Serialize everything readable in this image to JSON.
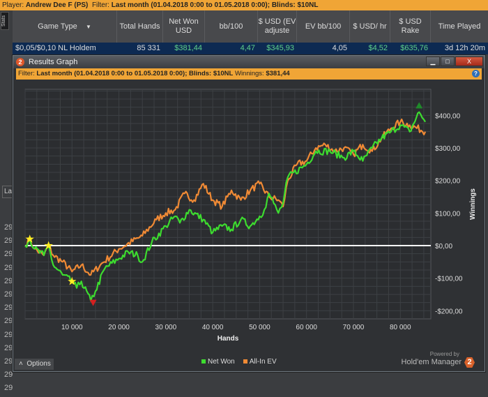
{
  "topbar": {
    "player_label": "Player:",
    "player": "Andrew Dee F (PS)",
    "filter_label": "Filter:",
    "filter": "Last month (01.04.2018 0:00 to 01.05.2018 0:00); Blinds: $10NL"
  },
  "stats_tab": "Stats",
  "table": {
    "headers": [
      "Game Type",
      "Total Hands",
      "Net Won USD",
      "bb/100",
      "$ USD (EV adjuste",
      "EV bb/100",
      "$ USD/ hr",
      "$ USD Rake",
      "Time Played"
    ],
    "row": [
      "$0,05/$0,10 NL Holdem",
      "85 331",
      "$381,44",
      "4,47",
      "$345,93",
      "4,05",
      "$4,52",
      "$635,76",
      "3d 12h 20m"
    ]
  },
  "left": {
    "la": "La",
    "rows": [
      "29",
      "29",
      "29",
      "29",
      "29",
      "29",
      "29",
      "29",
      "29",
      "29",
      "29",
      "29",
      "29"
    ]
  },
  "window": {
    "title": "Results Graph",
    "filter_label": "Filter:",
    "filter": "Last month (01.04.2018 0:00 to 01.05.2018 0:00); Blinds: $10NL",
    "winnings_label": "Winnings:",
    "winnings": "$381,44",
    "options": "Options",
    "powered": "Powered by",
    "brand": "Hold'em Manager",
    "brand_num": "2"
  },
  "colors": {
    "net_won": "#3ddc2f",
    "all_in_ev": "#f08a35",
    "accent": "#f0a536"
  },
  "chart_data": {
    "type": "line",
    "xlabel": "Hands",
    "ylabel": "Winnings",
    "xlim": [
      0,
      86500
    ],
    "ylim": [
      -225,
      480
    ],
    "xticks": [
      10000,
      20000,
      30000,
      40000,
      50000,
      60000,
      70000,
      80000
    ],
    "xtick_labels": [
      "10 000",
      "20 000",
      "30 000",
      "40 000",
      "50 000",
      "60 000",
      "70 000",
      "80 000"
    ],
    "yticks": [
      -200,
      -100,
      0,
      100,
      200,
      300,
      400
    ],
    "ytick_labels": [
      "-$200,00",
      "-$100,00",
      "$0,00",
      "$100,00",
      "$200,00",
      "$300,00",
      "$400,00"
    ],
    "grid": true,
    "legend": "bottom",
    "series": [
      {
        "name": "Net Won",
        "color": "#3ddc2f",
        "points": [
          [
            0,
            0
          ],
          [
            1000,
            20
          ],
          [
            2000,
            -10
          ],
          [
            4000,
            -30
          ],
          [
            5000,
            0
          ],
          [
            6000,
            -60
          ],
          [
            8000,
            -90
          ],
          [
            10000,
            -110
          ],
          [
            11000,
            -130
          ],
          [
            12000,
            -110
          ],
          [
            14000,
            -170
          ],
          [
            15000,
            -140
          ],
          [
            17000,
            -70
          ],
          [
            20000,
            -40
          ],
          [
            22000,
            -20
          ],
          [
            24000,
            -30
          ],
          [
            25000,
            -50
          ],
          [
            27000,
            10
          ],
          [
            30000,
            60
          ],
          [
            32000,
            90
          ],
          [
            33000,
            70
          ],
          [
            35000,
            110
          ],
          [
            38000,
            80
          ],
          [
            40000,
            40
          ],
          [
            42000,
            60
          ],
          [
            44000,
            50
          ],
          [
            46000,
            80
          ],
          [
            48000,
            60
          ],
          [
            50000,
            90
          ],
          [
            51000,
            110
          ],
          [
            52000,
            160
          ],
          [
            53000,
            130
          ],
          [
            54000,
            100
          ],
          [
            55000,
            130
          ],
          [
            56000,
            210
          ],
          [
            60000,
            250
          ],
          [
            62000,
            290
          ],
          [
            65000,
            290
          ],
          [
            68000,
            270
          ],
          [
            70000,
            290
          ],
          [
            72000,
            260
          ],
          [
            74000,
            300
          ],
          [
            76000,
            330
          ],
          [
            78000,
            350
          ],
          [
            80000,
            370
          ],
          [
            82000,
            350
          ],
          [
            84000,
            410
          ],
          [
            85331,
            380
          ]
        ]
      },
      {
        "name": "All-In EV",
        "color": "#f08a35",
        "points": [
          [
            0,
            0
          ],
          [
            1000,
            20
          ],
          [
            2000,
            -10
          ],
          [
            4000,
            -30
          ],
          [
            5000,
            0
          ],
          [
            6000,
            -30
          ],
          [
            8000,
            -50
          ],
          [
            10000,
            -80
          ],
          [
            12000,
            -60
          ],
          [
            14000,
            -90
          ],
          [
            16000,
            -60
          ],
          [
            20000,
            -10
          ],
          [
            25000,
            30
          ],
          [
            28000,
            80
          ],
          [
            30000,
            100
          ],
          [
            32000,
            110
          ],
          [
            34000,
            160
          ],
          [
            36000,
            140
          ],
          [
            38000,
            190
          ],
          [
            40000,
            140
          ],
          [
            42000,
            120
          ],
          [
            44000,
            170
          ],
          [
            46000,
            140
          ],
          [
            48000,
            170
          ],
          [
            50000,
            190
          ],
          [
            52000,
            150
          ],
          [
            54000,
            140
          ],
          [
            55000,
            120
          ],
          [
            56000,
            200
          ],
          [
            58000,
            250
          ],
          [
            60000,
            260
          ],
          [
            62000,
            300
          ],
          [
            64000,
            310
          ],
          [
            66000,
            290
          ],
          [
            68000,
            300
          ],
          [
            70000,
            280
          ],
          [
            72000,
            310
          ],
          [
            74000,
            290
          ],
          [
            76000,
            330
          ],
          [
            78000,
            360
          ],
          [
            80000,
            380
          ],
          [
            82000,
            370
          ],
          [
            85331,
            350
          ]
        ]
      }
    ],
    "markers": [
      {
        "type": "star",
        "x": 1000,
        "y": 20
      },
      {
        "type": "star",
        "x": 5000,
        "y": 0
      },
      {
        "type": "star",
        "x": 10000,
        "y": -110
      },
      {
        "type": "max",
        "x": 84000,
        "y": 430
      },
      {
        "type": "min",
        "x": 14500,
        "y": -175
      }
    ]
  }
}
